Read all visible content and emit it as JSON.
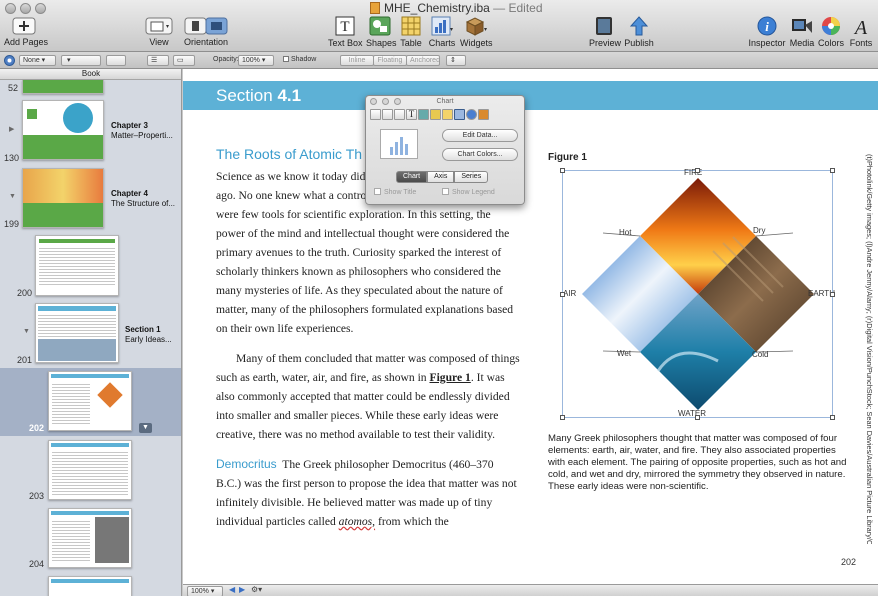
{
  "window": {
    "title": "MHE_Chemistry.iba",
    "status": "— Edited"
  },
  "toolbar": {
    "add_pages": "Add Pages",
    "view": "View",
    "orientation": "Orientation",
    "text_box": "Text Box",
    "shapes": "Shapes",
    "table": "Table",
    "charts": "Charts",
    "widgets": "Widgets",
    "preview": "Preview",
    "publish": "Publish",
    "inspector": "Inspector",
    "media": "Media",
    "colors": "Colors",
    "fonts": "Fonts"
  },
  "format_bar": {
    "stroke_value": "None",
    "opacity_label": "Opacity:",
    "opacity_value": "100%",
    "shadow_label": "Shadow",
    "inline": "Inline",
    "floating": "Floating",
    "anchored": "Anchored"
  },
  "sidebar": {
    "header": "Book",
    "pages": [
      {
        "num": "52"
      },
      {
        "num": "130",
        "chapter": "Chapter 3",
        "subtitle": "Matter–Properti..."
      },
      {
        "num": "199",
        "chapter": "Chapter 4",
        "subtitle": "The Structure of..."
      },
      {
        "num": "200"
      },
      {
        "num": "201",
        "chapter": "Section 1",
        "subtitle": "Early Ideas..."
      },
      {
        "num": "202"
      },
      {
        "num": "203"
      },
      {
        "num": "204"
      }
    ]
  },
  "page": {
    "section_label": "Section",
    "section_number": "4.1",
    "heading": "The Roots of Atomic Th",
    "para1": "Science as we know it today did not exist several thousand years ago. No one knew what a controlled experiment was, and there were few tools for scientific exploration. In this setting, the power of the mind and intellectual thought were considered the primary avenues to the truth. Curiosity sparked the interest of scholarly thinkers known as philosophers who considered the many mysteries of life. As they speculated about the nature of matter, many of the philosophers formulated explanations based on their own life experiences.",
    "para2_start": "Many of them concluded that matter was composed of things such as earth, water, air, and fire, as shown in ",
    "para2_link": "Figure 1",
    "para2_end": ". It was also commonly accepted that matter could be endlessly divided into smaller and smaller pieces. While these early ideas were creative, there was no method available to test their validity.",
    "para3_runin": "Democritus",
    "para3_text": "The Greek philosopher Democritus (460–370 B.C.) was the first person to propose the idea that matter was not infinitely divisible. He believed matter was made up of tiny individual particles called ",
    "para3_term": "atomos,",
    "para3_end": " from which the",
    "figure_label": "Figure 1",
    "figure_labels": {
      "fire": "FIRE",
      "water": "WATER",
      "air": "AIR",
      "earth": "EARTH",
      "hot": "Hot",
      "dry": "Dry",
      "wet": "Wet",
      "cold": "Cold"
    },
    "caption": "Many Greek philosophers thought that matter was composed of four elements: earth, air, water, and fire. They also associated properties with each element. The pairing of opposite properties, such as hot and cold, and wet and dry, mirrored the symmetry they observed in nature. These early ideas were non-scientific.",
    "credit": "(t)Photolink/Getty images; (l)Andre Jenny/Alamy; (r)Digital Vision/PunchStock; Sean Davies/Australian Picture Library/Corbis",
    "page_number": "202"
  },
  "chart_inspector": {
    "title": "Chart",
    "edit_data": "Edit Data...",
    "chart_colors": "Chart Colors...",
    "tabs": [
      "Chart",
      "Axis",
      "Series"
    ],
    "show_title": "Show Title",
    "show_legend": "Show Legend"
  },
  "status_bar": {
    "zoom": "100%"
  },
  "colors": {
    "accent": "#3a9ccd",
    "section_band": "#5db1d6",
    "selection": "#a4b1c6"
  }
}
